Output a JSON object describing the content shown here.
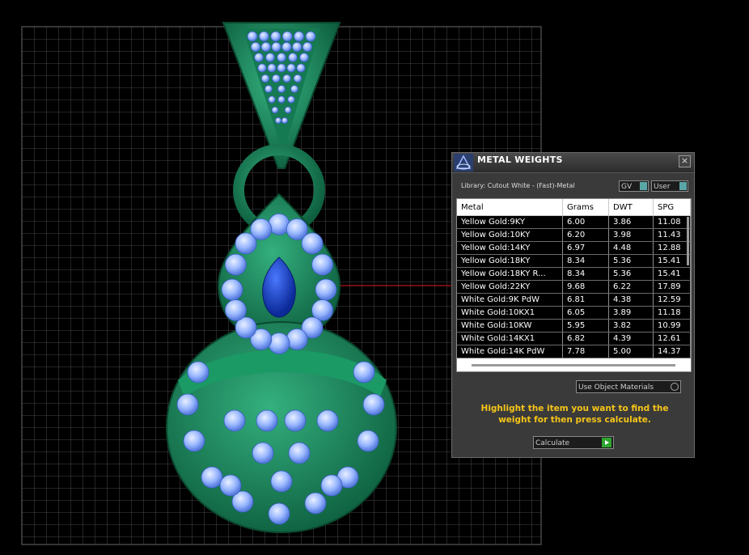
{
  "dialog": {
    "title": "METAL WEIGHTS",
    "close_label": "×",
    "library_label": "Library: Cutout White - (Fast)-Metal",
    "gv_label": "GV",
    "user_label": "User",
    "table": {
      "columns": [
        "Metal",
        "Grams",
        "DWT",
        "SPG"
      ],
      "rows": [
        [
          "Yellow Gold:9KY",
          "6.00",
          "3.86",
          "11.08"
        ],
        [
          "Yellow Gold:10KY",
          "6.20",
          "3.98",
          "11.43"
        ],
        [
          "Yellow Gold:14KY",
          "6.97",
          "4.48",
          "12.88"
        ],
        [
          "Yellow Gold:18KY",
          "8.34",
          "5.36",
          "15.41"
        ],
        [
          "Yellow Gold:18KY R...",
          "8.34",
          "5.36",
          "15.41"
        ],
        [
          "Yellow Gold:22KY",
          "9.68",
          "6.22",
          "17.89"
        ],
        [
          "White Gold:9K PdW",
          "6.81",
          "4.38",
          "12.59"
        ],
        [
          "White Gold:10KX1",
          "6.05",
          "3.89",
          "11.18"
        ],
        [
          "White Gold:10KW",
          "5.95",
          "3.82",
          "10.99"
        ],
        [
          "White Gold:14KX1",
          "6.82",
          "4.39",
          "12.61"
        ],
        [
          "White Gold:14K PdW",
          "7.78",
          "5.00",
          "14.37"
        ]
      ]
    },
    "use_object_materials_label": "Use Object Materials",
    "instruction": "Highlight the item you want to find the weight for then press calculate.",
    "calculate_label": "Calculate",
    "colors": {
      "instruction": "#f5c518",
      "metal": "#1f8f63",
      "gem": "#8fb2ff",
      "center_gem": "#1e4bd1"
    }
  }
}
